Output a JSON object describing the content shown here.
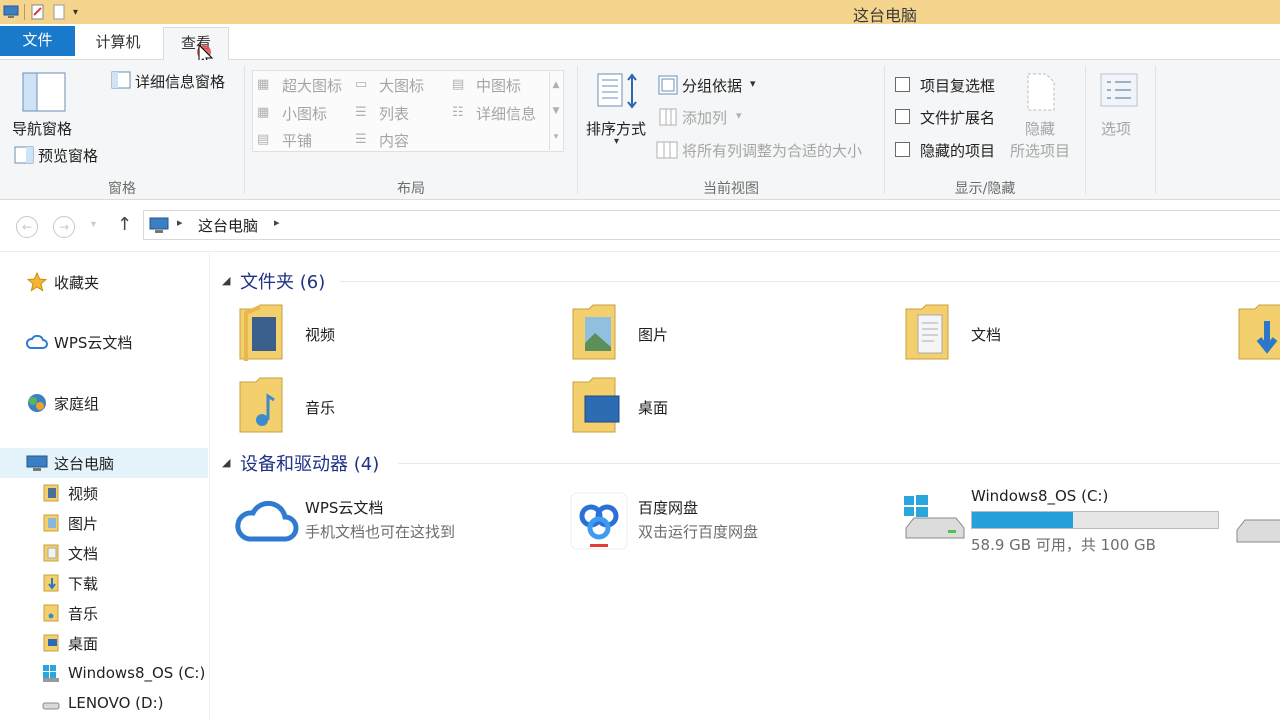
{
  "window": {
    "title": "这台电脑"
  },
  "tabs": {
    "file": "文件",
    "computer": "计算机",
    "view": "查看"
  },
  "ribbon": {
    "panes": {
      "group_label": "窗格",
      "nav_pane": "导航窗格",
      "preview_pane": "预览窗格",
      "details_pane": "详细信息窗格"
    },
    "layout": {
      "group_label": "布局",
      "extra_large": "超大图标",
      "large": "大图标",
      "medium": "中图标",
      "small": "小图标",
      "list": "列表",
      "details": "详细信息",
      "tiles": "平铺",
      "content": "内容"
    },
    "current_view": {
      "group_label": "当前视图",
      "sort_by": "排序方式",
      "group_by": "分组依据",
      "add_columns": "添加列",
      "size_all_columns": "将所有列调整为合适的大小"
    },
    "show_hide": {
      "group_label": "显示/隐藏",
      "item_checkboxes": "项目复选框",
      "file_extensions": "文件扩展名",
      "hidden_items": "隐藏的项目",
      "hide_selected_1": "隐藏",
      "hide_selected_2": "所选项目"
    },
    "options": {
      "label": "选项"
    }
  },
  "address": {
    "crumbs": [
      "这台电脑"
    ]
  },
  "nav": {
    "favorites": "收藏夹",
    "wps": "WPS云文档",
    "homegroup": "家庭组",
    "this_pc": "这台电脑",
    "children": [
      "视频",
      "图片",
      "文档",
      "下载",
      "音乐",
      "桌面",
      "Windows8_OS (C:)",
      "LENOVO (D:)"
    ]
  },
  "content": {
    "folders_header": "文件夹 (6)",
    "folders": [
      "视频",
      "图片",
      "文档",
      "音乐",
      "桌面"
    ],
    "devices_header": "设备和驱动器 (4)",
    "devices": {
      "wps_title": "WPS云文档",
      "wps_sub": "手机文档也可在这找到",
      "baidu_title": "百度网盘",
      "baidu_sub": "双击运行百度网盘",
      "c_title": "Windows8_OS (C:)",
      "c_sub": "58.9 GB 可用，共 100 GB",
      "c_used_fraction": 0.411
    }
  },
  "colors": {
    "accent": "#1979ca",
    "titlebar": "#f5d48e",
    "drive_fill": "#26a0da"
  }
}
